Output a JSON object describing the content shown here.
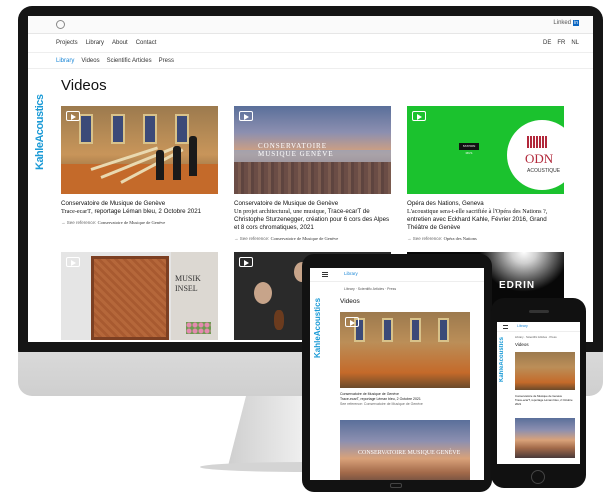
{
  "topbar": {
    "linkedin_label": "Linked",
    "linkedin_badge": "in"
  },
  "nav": {
    "items": [
      "Projects",
      "Library",
      "About",
      "Contact"
    ],
    "languages": [
      "DE",
      "FR",
      "NL"
    ]
  },
  "subnav": {
    "items": [
      "Library",
      "Videos",
      "Scientific Articles",
      "Press"
    ],
    "active": "Library"
  },
  "logo": "KahleAcoustics",
  "page_title": "Videos",
  "cards": [
    {
      "title": "Conservatoire de Musique de Genève",
      "subtitle_fancy": "Trace-ecarT",
      "subtitle_rest": ", reportage Léman bleu, 2 Octobre 2021",
      "ref_label": "See reference:",
      "ref_value": "Conservatoire de Musique de Genève"
    },
    {
      "title": "Conservatoire de Musique de Genève",
      "subtitle_fancy": "Un projet architectural, une musique,",
      "subtitle_rest": " Trace-ecarT de Christophe Sturzenegger, création pour 6 cors des Alpes et 8 cors chromatiques, 2021",
      "ref_label": "See reference:",
      "ref_value": "Conservatoire de Musique de Genève"
    },
    {
      "title": "Opéra des Nations, Geneva",
      "subtitle_fancy": "L'acoustique sera-t-elle sacrifiée à l'Opéra des Nations ?,",
      "subtitle_rest": " entretien avec Eckhard Kahle, Février 2016, Grand Théâtre de Genève",
      "ref_label": "See reference:",
      "ref_value": "Opéra des Nations"
    }
  ],
  "thumb_text": {
    "conservatoire_logo_line1": "CONSERVATOIRE",
    "conservatoire_logo_line2": "MUSIQUE GENÈVE",
    "odn": "ODN",
    "acoustique": "ACOUSTIQUE",
    "station": "STATION MUS",
    "musik_line1": "MUSIK",
    "musik_line2": "INSEL",
    "edrin": "EDRIN"
  },
  "tablet": {
    "library": "Library",
    "breadcrumb": "Library  ·  Scientific Articles  ·  Press",
    "title": "Videos",
    "caption_line1": "Conservatoire de Musique de Genève",
    "caption_line2": "Trace-ecarT, reportage Léman bleu, 2 Octobre 2021",
    "caption_ref": "See reference: Conservatoire de Musique de Genève",
    "img2_logo": "CONSERVATOIRE MUSIQUE GENÈVE"
  },
  "phone": {
    "library": "Library",
    "breadcrumb": "Library · Scientific Articles · Press",
    "title": "Videos",
    "caption_line1": "Conservatoire de Musique de Genève",
    "caption_line2": "Trace-ecarT, reportage Léman bleu, 2 Octobre 2021"
  }
}
